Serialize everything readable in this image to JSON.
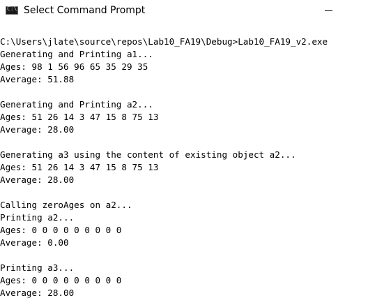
{
  "window": {
    "title": "Select Command Prompt",
    "icon": "cmd-icon"
  },
  "controls": {
    "minimize_icon": "minimize-icon"
  },
  "console": {
    "lines": [
      "C:\\Users\\jlate\\source\\repos\\Lab10_FA19\\Debug>Lab10_FA19_v2.exe",
      "Generating and Printing a1...",
      "Ages: 98 1 56 96 65 35 29 35",
      "Average: 51.88",
      "",
      "Generating and Printing a2...",
      "Ages: 51 26 14 3 47 15 8 75 13",
      "Average: 28.00",
      "",
      "Generating a3 using the content of existing object a2...",
      "Ages: 51 26 14 3 47 15 8 75 13",
      "Average: 28.00",
      "",
      "Calling zeroAges on a2...",
      "Printing a2...",
      "Ages: 0 0 0 0 0 0 0 0 0",
      "Average: 0.00",
      "",
      "Printing a3...",
      "Ages: 0 0 0 0 0 0 0 0 0",
      "Average: 28.00"
    ]
  }
}
